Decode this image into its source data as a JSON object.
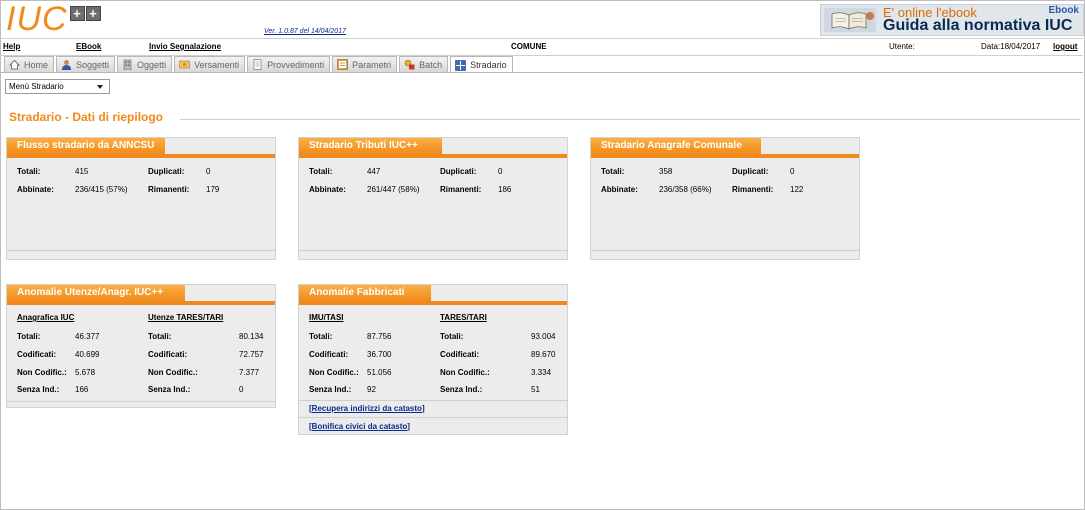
{
  "header": {
    "logo_text": "IUC",
    "logo_plus": "++",
    "version": "Ver. 1.0.87 del 14/04/2017",
    "ebook_banner": {
      "line1": "E' online l'ebook",
      "line2": "Guida alla normativa IUC",
      "tag": "Ebook"
    }
  },
  "menubar": {
    "help": "Help",
    "ebook": "EBook",
    "invio": "Invio Segnalazione",
    "comune": "COMUNE",
    "utente": "Utente:",
    "data": "Data:18/04/2017",
    "logout": "logout"
  },
  "tabs": [
    {
      "label": "Home",
      "icon": "home-icon"
    },
    {
      "label": "Soggetti",
      "icon": "user-icon"
    },
    {
      "label": "Oggetti",
      "icon": "building-icon"
    },
    {
      "label": "Versamenti",
      "icon": "payment-icon"
    },
    {
      "label": "Provvedimenti",
      "icon": "document-icon"
    },
    {
      "label": "Parametri",
      "icon": "settings-icon"
    },
    {
      "label": "Batch",
      "icon": "batch-icon"
    },
    {
      "label": "Stradario",
      "icon": "map-icon"
    }
  ],
  "menu_select": {
    "value": "Menù Stradario"
  },
  "page": {
    "title": "Stradario - Dati di riepilogo"
  },
  "panels": {
    "anncsu": {
      "title": "Flusso stradario da ANNCSU",
      "totali_label": "Totali:",
      "totali": "415",
      "duplicati_label": "Duplicati:",
      "duplicati": "0",
      "abbinate_label": "Abbinate:",
      "abbinate": "236/415 (57%)",
      "rimanenti_label": "Rimanenti:",
      "rimanenti": "179"
    },
    "tributi": {
      "title": "Stradario Tributi IUC++",
      "totali_label": "Totali:",
      "totali": "447",
      "duplicati_label": "Duplicati:",
      "duplicati": "0",
      "abbinate_label": "Abbinate:",
      "abbinate": "261/447 (58%)",
      "rimanenti_label": "Rimanenti:",
      "rimanenti": "186"
    },
    "anagrafe": {
      "title": "Stradario Anagrafe Comunale",
      "totali_label": "Totali:",
      "totali": "358",
      "duplicati_label": "Duplicati:",
      "duplicati": "0",
      "abbinate_label": "Abbinate:",
      "abbinate": "236/358 (66%)",
      "rimanenti_label": "Rimanenti:",
      "rimanenti": "122"
    },
    "utenze": {
      "title": "Anomalie Utenze/Anagr. IUC++",
      "col1_header": "Anagrafica IUC",
      "col2_header": "Utenze TARES/TARI",
      "rows": [
        {
          "label": "Totali:",
          "v1": "46.377",
          "v2": "80.134"
        },
        {
          "label": "Codificati:",
          "v1": "40.699",
          "v2": "72.757"
        },
        {
          "label": "Non Codific.:",
          "v1": "5.678",
          "v2": "7.377"
        },
        {
          "label": "Senza Ind.:",
          "v1": "166",
          "v2": "0"
        }
      ]
    },
    "fabbricati": {
      "title": "Anomalie Fabbricati",
      "col1_header": "IMU/TASI",
      "col2_header": "TARES/TARI",
      "rows": [
        {
          "label": "Totali:",
          "v1": "87.756",
          "v2": "93.004"
        },
        {
          "label": "Codificati:",
          "v1": "36.700",
          "v2": "89.670"
        },
        {
          "label": "Non Codific.:",
          "v1": "51.056",
          "v2": "3.334"
        },
        {
          "label": "Senza Ind.:",
          "v1": "92",
          "v2": "51"
        }
      ],
      "link1": "Recupera indirizzi da catasto",
      "link2": "Bonifica civici da catasto"
    }
  },
  "colors": {
    "accent": "#f08a1c",
    "panel_bg": "#ececec",
    "link": "#0b2a8a"
  }
}
